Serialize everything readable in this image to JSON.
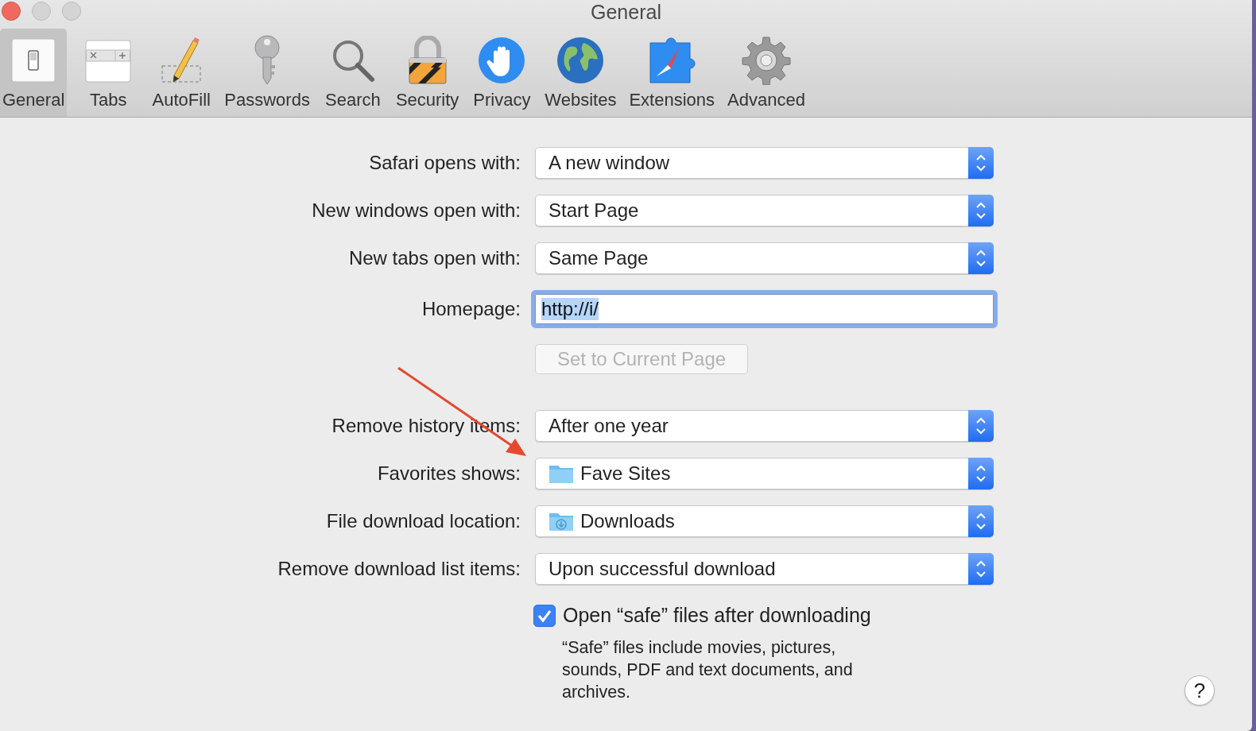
{
  "window": {
    "title": "General"
  },
  "toolbar": {
    "items": [
      {
        "label": "General",
        "kind": "switch",
        "selected": true
      },
      {
        "label": "Tabs",
        "kind": "tabs",
        "selected": false
      },
      {
        "label": "AutoFill",
        "kind": "pencil",
        "selected": false
      },
      {
        "label": "Passwords",
        "kind": "key",
        "selected": false
      },
      {
        "label": "Search",
        "kind": "magnifier",
        "selected": false
      },
      {
        "label": "Security",
        "kind": "padlock",
        "selected": false
      },
      {
        "label": "Privacy",
        "kind": "hand",
        "selected": false
      },
      {
        "label": "Websites",
        "kind": "globe",
        "selected": false
      },
      {
        "label": "Extensions",
        "kind": "compass",
        "selected": false
      },
      {
        "label": "Advanced",
        "kind": "gear",
        "selected": false
      }
    ]
  },
  "form": {
    "rows": [
      {
        "kind": "popup",
        "label": "Safari opens with:",
        "value": "A new window"
      },
      {
        "kind": "popup",
        "label": "New windows open with:",
        "value": "Start Page"
      },
      {
        "kind": "popup",
        "label": "New tabs open with:",
        "value": "Same Page"
      },
      {
        "kind": "text-field",
        "label": "Homepage:",
        "value": "http://i/",
        "text_selected": true
      },
      {
        "kind": "button",
        "label": "Set to Current Page",
        "disabled": true
      },
      {
        "kind": "popup",
        "label": "Remove history items:",
        "value": "After one year"
      },
      {
        "kind": "folder",
        "label": "Favorites shows:",
        "value": "Fave Sites"
      },
      {
        "kind": "downloads",
        "label": "File download location:",
        "value": "Downloads"
      },
      {
        "kind": "popup",
        "label": "Remove download list items:",
        "value": "Upon successful download"
      }
    ]
  },
  "checkbox": {
    "label": "Open “safe” files after downloading",
    "checked": true,
    "description": "“Safe” files include movies, pictures, sounds, PDF and text documents, and archives."
  },
  "help_button": {
    "label": "?"
  }
}
